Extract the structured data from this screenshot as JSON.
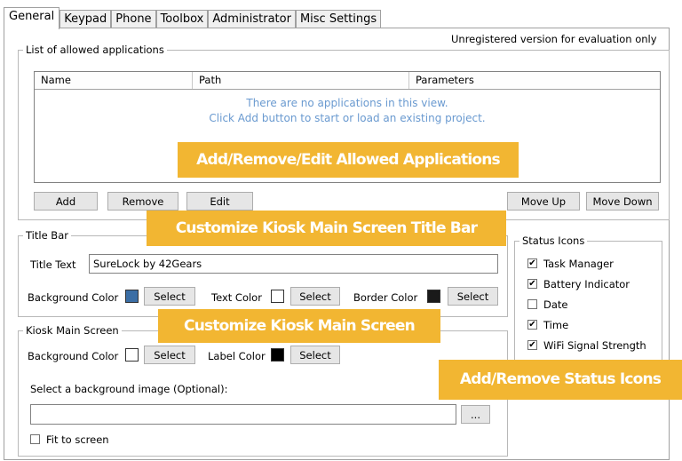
{
  "tabs": [
    {
      "label": "General",
      "active": true
    },
    {
      "label": "Keypad",
      "active": false
    },
    {
      "label": "Phone",
      "active": false
    },
    {
      "label": "Toolbox",
      "active": false
    },
    {
      "label": "Administrator",
      "active": false
    },
    {
      "label": "Misc Settings",
      "active": false
    }
  ],
  "notice": "Unregistered version for evaluation only",
  "allowed_apps": {
    "legend": "List of allowed applications",
    "columns": [
      "Name",
      "Path",
      "Parameters"
    ],
    "empty_line1": "There are no applications in this view.",
    "empty_line2": "Click Add button to start or load an existing project.",
    "buttons": {
      "add": "Add",
      "remove": "Remove",
      "edit": "Edit",
      "move_up": "Move Up",
      "move_down": "Move Down"
    }
  },
  "title_bar": {
    "legend": "Title Bar",
    "title_text_label": "Title Text",
    "title_text_value": "SureLock by 42Gears",
    "bg_color_label": "Background Color",
    "bg_color": "#3b6ea5",
    "text_color_label": "Text Color",
    "text_color": "#ffffff",
    "border_color_label": "Border Color",
    "border_color": "#1a1a1a",
    "select_label": "Select"
  },
  "kiosk_main": {
    "legend": "Kiosk Main Screen",
    "bg_color_label": "Background Color",
    "bg_color": "#ffffff",
    "label_color_label": "Label Color",
    "label_color": "#000000",
    "select_label": "Select",
    "bg_image_label": "Select a background image (Optional):",
    "bg_image_value": "",
    "browse_label": "...",
    "fit_label": "Fit to screen",
    "fit_checked": false
  },
  "status_icons": {
    "legend": "Status Icons",
    "items": [
      {
        "label": "Task Manager",
        "checked": true
      },
      {
        "label": "Battery Indicator",
        "checked": true
      },
      {
        "label": "Date",
        "checked": false
      },
      {
        "label": "Time",
        "checked": true
      },
      {
        "label": "WiFi Signal Strength",
        "checked": true
      }
    ]
  },
  "callouts": {
    "apps": "Add/Remove/Edit Allowed Applications",
    "title_bar": "Customize Kiosk Main Screen Title Bar",
    "main_screen": "Customize Kiosk Main Screen",
    "status_icons": "Add/Remove Status Icons"
  },
  "accent_color": "#f2b632"
}
